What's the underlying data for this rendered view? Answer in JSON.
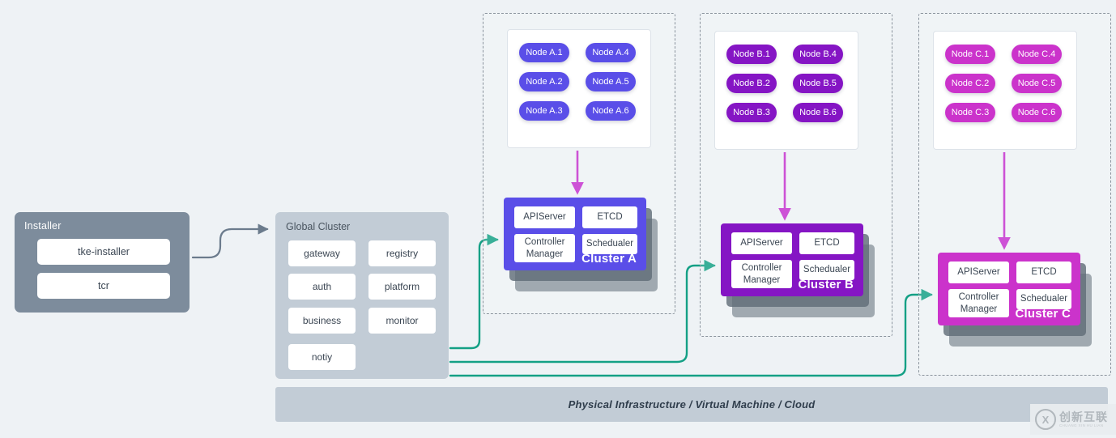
{
  "installer": {
    "title": "Installer",
    "items": [
      "tke-installer",
      "tcr"
    ]
  },
  "global_cluster": {
    "title": "Global Cluster",
    "items": [
      "gateway",
      "registry",
      "auth",
      "platform",
      "business",
      "monitor",
      "notiy"
    ]
  },
  "clusters": [
    {
      "name": "Cluster A",
      "accent": "#5a4ee8",
      "node_color": "#5a4ee8",
      "nodes": [
        "Node A.1",
        "Node A.4",
        "Node A.2",
        "Node A.5",
        "Node A.3",
        "Node A.6"
      ],
      "components": {
        "apiserver": "APIServer",
        "etcd": "ETCD",
        "controller_manager": "Controller Manager",
        "scheduler": "Schedualer"
      }
    },
    {
      "name": "Cluster B",
      "accent": "#8515c4",
      "node_color": "#8515c4",
      "nodes": [
        "Node B.1",
        "Node B.4",
        "Node B.2",
        "Node B.5",
        "Node B.3",
        "Node B.6"
      ],
      "components": {
        "apiserver": "APIServer",
        "etcd": "ETCD",
        "controller_manager": "Controller Manager",
        "scheduler": "Schedualer"
      }
    },
    {
      "name": "Cluster C",
      "accent": "#cb33cb",
      "node_color": "#cb33cb",
      "nodes": [
        "Node C.1",
        "Node C.4",
        "Node C.2",
        "Node C.5",
        "Node C.3",
        "Node C.6"
      ],
      "components": {
        "apiserver": "APIServer",
        "etcd": "ETCD",
        "controller_manager": "Controller Manager",
        "scheduler": "Schedualer"
      }
    }
  ],
  "infrastructure": {
    "label": "Physical Infrastructure / Virtual Machine / Cloud"
  },
  "watermark": {
    "mark": "X",
    "chinese": "创新互联",
    "pinyin": "CHUANG XIN HU LIAN"
  },
  "colors": {
    "background": "#eef2f5",
    "installer_bg": "#7d8c9c",
    "global_bg": "#c2ccd6",
    "infra_bg": "#c2ccd6",
    "connector_teal": "#14a085",
    "connector_gray": "#6b7b8c",
    "node_arrow_magenta": "#c432cf",
    "card_shadow": "#5f6b77",
    "region_border": "#8a939d"
  }
}
